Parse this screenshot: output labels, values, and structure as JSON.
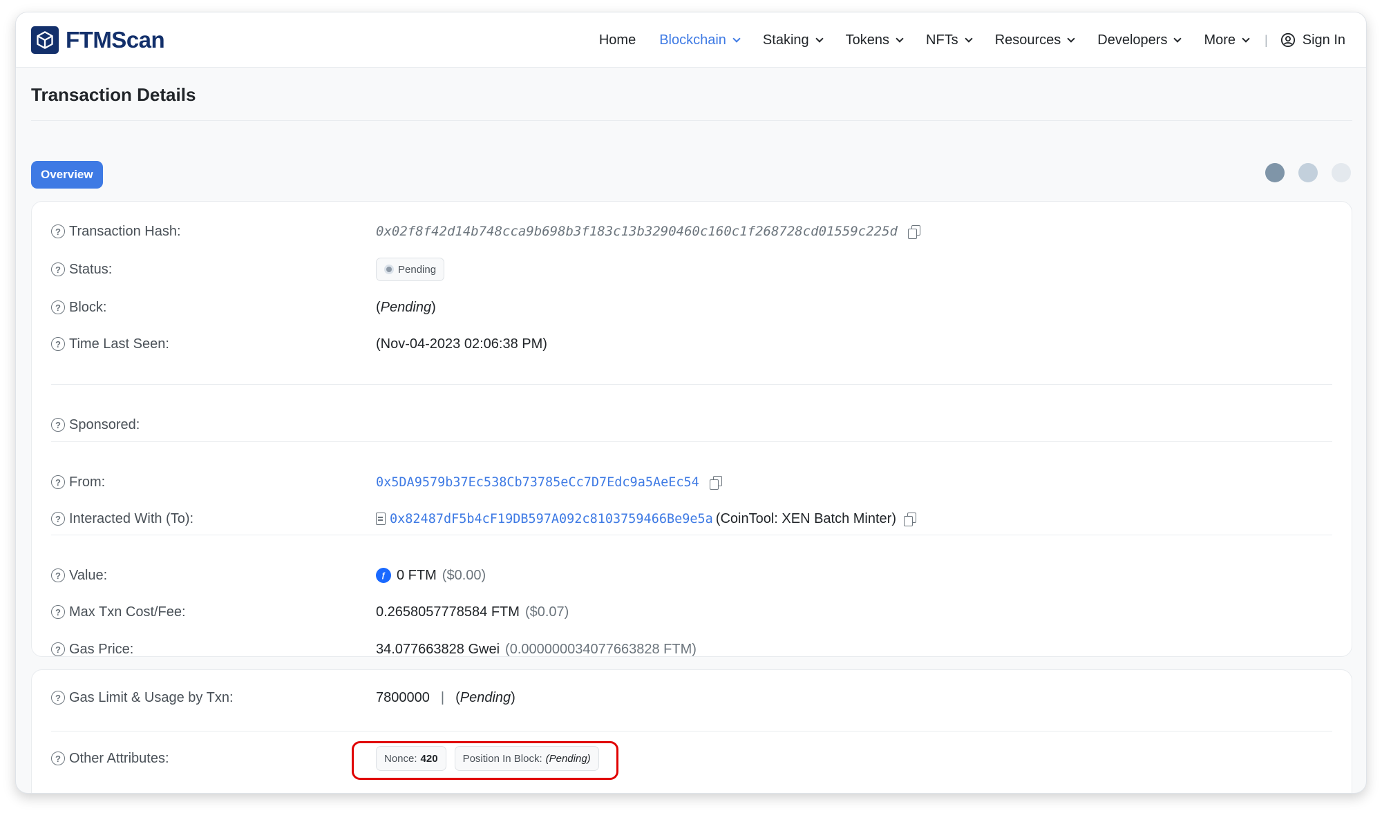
{
  "header": {
    "logo_text": "FTMScan",
    "nav": [
      {
        "label": "Home",
        "dropdown": false,
        "active": false
      },
      {
        "label": "Blockchain",
        "dropdown": true,
        "active": true
      },
      {
        "label": "Staking",
        "dropdown": true,
        "active": false
      },
      {
        "label": "Tokens",
        "dropdown": true,
        "active": false
      },
      {
        "label": "NFTs",
        "dropdown": true,
        "active": false
      },
      {
        "label": "Resources",
        "dropdown": true,
        "active": false
      },
      {
        "label": "Developers",
        "dropdown": true,
        "active": false
      },
      {
        "label": "More",
        "dropdown": true,
        "active": false
      }
    ],
    "separator": "|",
    "sign_in": "Sign In"
  },
  "page_title": "Transaction Details",
  "tabs": {
    "overview": "Overview"
  },
  "dot_colors": [
    "#7f95a8",
    "#c3d0dc",
    "#e4e9ee"
  ],
  "fields": {
    "tx_hash": {
      "label": "Transaction Hash:",
      "value": "0x02f8f42d14b748cca9b698b3f183c13b3290460c160c1f268728cd01559c225d"
    },
    "status": {
      "label": "Status:",
      "value": "Pending"
    },
    "block": {
      "label": "Block:",
      "open": "(",
      "value": "Pending",
      "close": ")"
    },
    "time_last_seen": {
      "label": "Time Last Seen:",
      "value": "(Nov-04-2023 02:06:38 PM)"
    },
    "sponsored": {
      "label": "Sponsored:"
    },
    "from": {
      "label": "From:",
      "value": "0x5DA9579b37Ec538Cb73785eCc7D7Edc9a5AeEc54"
    },
    "to": {
      "label": "Interacted With (To):",
      "value": "0x82487dF5b4cF19DB597A092c8103759466Be9e5a",
      "name": "(CoinTool: XEN Batch Minter)"
    },
    "value": {
      "label": "Value:",
      "amount": "0 FTM",
      "usd": "($0.00)"
    },
    "max_fee": {
      "label": "Max Txn Cost/Fee:",
      "amount": "0.2658057778584 FTM",
      "usd": "($0.07)"
    },
    "gas_price": {
      "label": "Gas Price:",
      "amount": "34.077663828 Gwei",
      "ftm": "(0.000000034077663828 FTM)"
    },
    "gas_limit": {
      "label": "Gas Limit & Usage by Txn:",
      "limit": "7800000",
      "sep": "|",
      "open": "(",
      "usage": "Pending",
      "close": ")"
    },
    "other_attributes": {
      "label": "Other Attributes:",
      "nonce_label": "Nonce:",
      "nonce_value": "420",
      "position_label": "Position In Block:",
      "position_value": "(Pending)"
    }
  },
  "colors": {
    "accent": "#3e7ae4",
    "brand": "#13306b",
    "highlight": "#e00000"
  }
}
